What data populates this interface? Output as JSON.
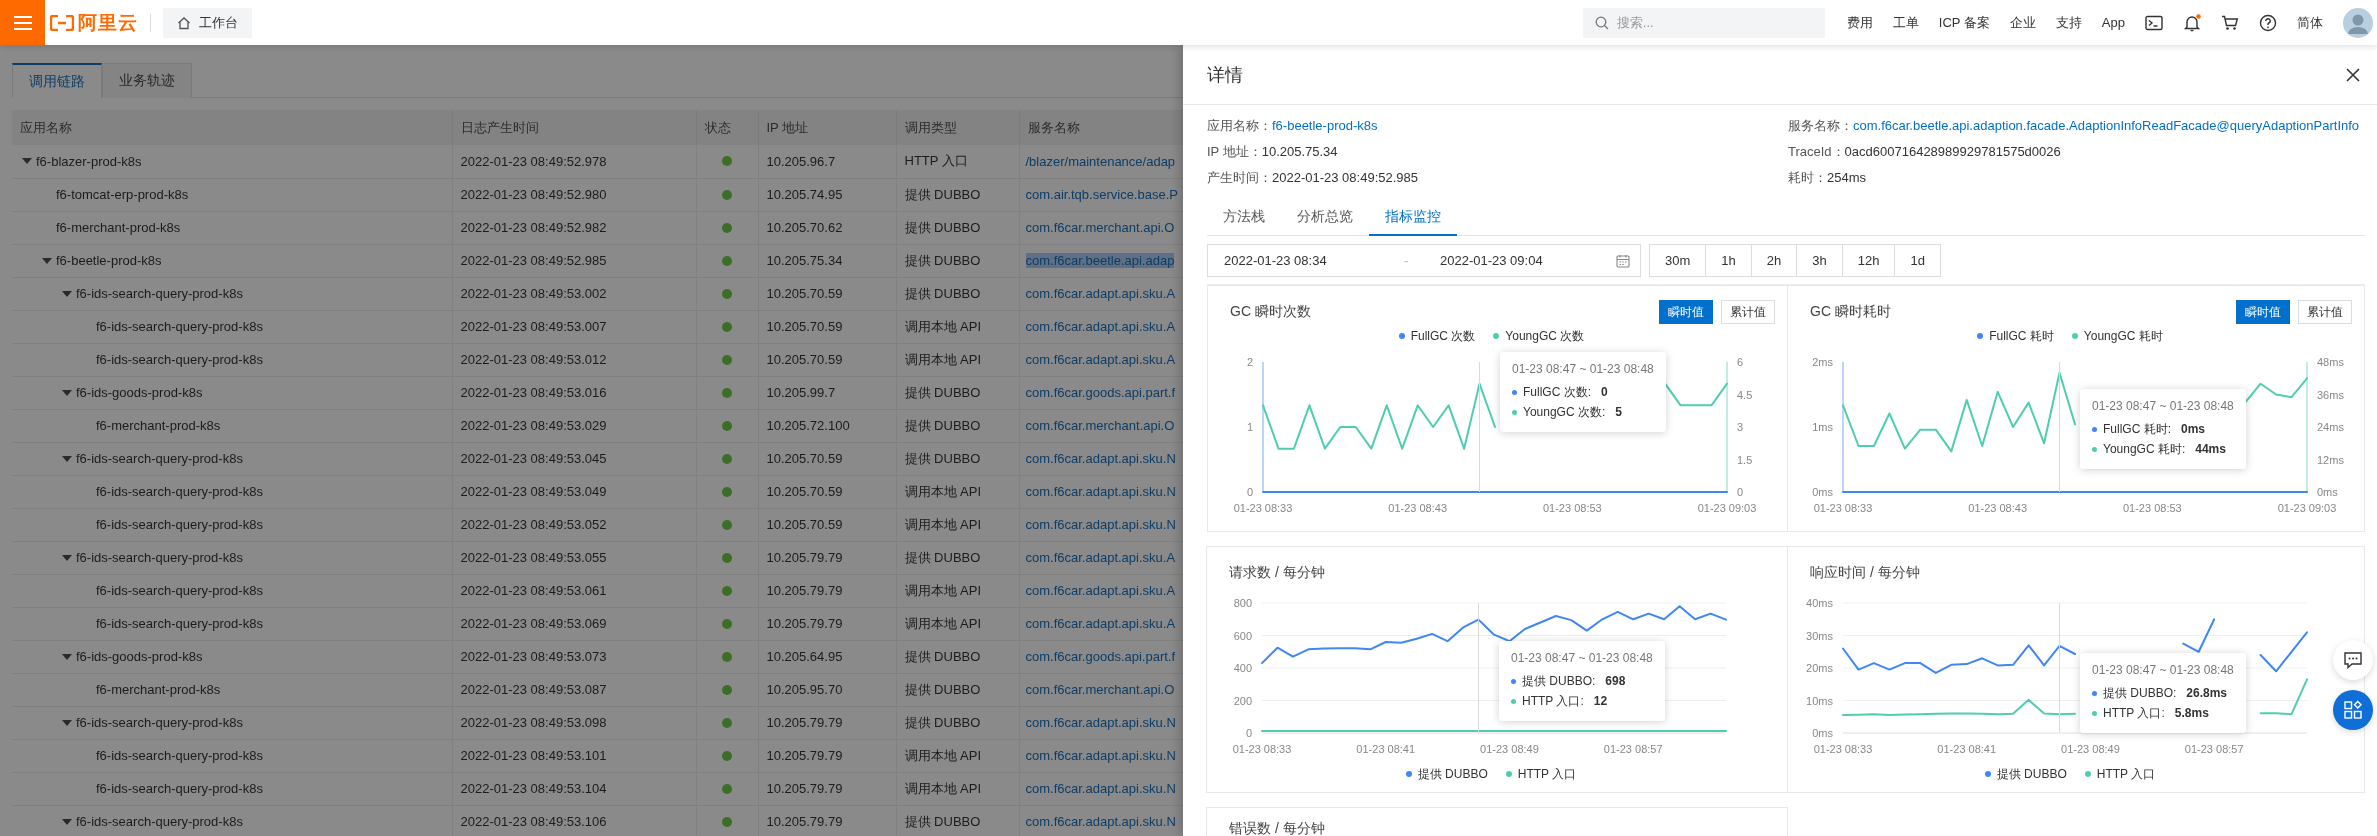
{
  "topbar": {
    "logo": "阿里云",
    "workbench": "工作台",
    "search": {
      "placeholder": "搜索..."
    },
    "links": [
      "费用",
      "工单",
      "ICP 备案",
      "企业",
      "支持",
      "App"
    ],
    "language": "简体"
  },
  "main": {
    "tabs": [
      {
        "label": "调用链路",
        "selected": true
      },
      {
        "label": "业务轨迹",
        "selected": false
      }
    ],
    "table": {
      "columns": [
        "应用名称",
        "日志产生时间",
        "状态",
        "IP 地址",
        "调用类型",
        "服务名称"
      ],
      "rows": [
        {
          "app": "f6-blazer-prod-k8s",
          "time": "2022-01-23 08:49:52.978",
          "ip": "10.205.96.7",
          "call_type": "HTTP 入口",
          "service": "/blazer/maintenance/adap",
          "selected": false,
          "expanded": true,
          "children": [
            {
              "app": "f6-tomcat-erp-prod-k8s",
              "time": "2022-01-23 08:49:52.980",
              "ip": "10.205.74.95",
              "call_type": "提供 DUBBO",
              "service": "com.air.tqb.service.base.P",
              "selected": false
            },
            {
              "app": "f6-merchant-prod-k8s",
              "time": "2022-01-23 08:49:52.982",
              "ip": "10.205.70.62",
              "call_type": "提供 DUBBO",
              "service": "com.f6car.merchant.api.O",
              "selected": false
            },
            {
              "app": "f6-beetle-prod-k8s",
              "time": "2022-01-23 08:49:52.985",
              "ip": "10.205.75.34",
              "call_type": "提供 DUBBO",
              "service": "com.f6car.beetle.api.adap",
              "selected": true,
              "expanded": true,
              "children": [
                {
                  "app": "f6-ids-search-query-prod-k8s",
                  "time": "2022-01-23 08:49:53.002",
                  "ip": "10.205.70.59",
                  "call_type": "提供 DUBBO",
                  "service": "com.f6car.adapt.api.sku.A",
                  "selected": false,
                  "expanded": true,
                  "children": [
                    {
                      "app": "f6-ids-search-query-prod-k8s",
                      "time": "2022-01-23 08:49:53.007",
                      "ip": "10.205.70.59",
                      "call_type": "调用本地 API",
                      "service": "com.f6car.adapt.api.sku.A",
                      "selected": false
                    },
                    {
                      "app": "f6-ids-search-query-prod-k8s",
                      "time": "2022-01-23 08:49:53.012",
                      "ip": "10.205.70.59",
                      "call_type": "调用本地 API",
                      "service": "com.f6car.adapt.api.sku.A",
                      "selected": false
                    }
                  ]
                },
                {
                  "app": "f6-ids-goods-prod-k8s",
                  "time": "2022-01-23 08:49:53.016",
                  "ip": "10.205.99.7",
                  "call_type": "提供 DUBBO",
                  "service": "com.f6car.goods.api.part.f",
                  "selected": false,
                  "expanded": true,
                  "children": [
                    {
                      "app": "f6-merchant-prod-k8s",
                      "time": "2022-01-23 08:49:53.029",
                      "ip": "10.205.72.100",
                      "call_type": "提供 DUBBO",
                      "service": "com.f6car.merchant.api.O",
                      "selected": false
                    }
                  ]
                },
                {
                  "app": "f6-ids-search-query-prod-k8s",
                  "time": "2022-01-23 08:49:53.045",
                  "ip": "10.205.70.59",
                  "call_type": "提供 DUBBO",
                  "service": "com.f6car.adapt.api.sku.N",
                  "selected": false,
                  "expanded": true,
                  "children": [
                    {
                      "app": "f6-ids-search-query-prod-k8s",
                      "time": "2022-01-23 08:49:53.049",
                      "ip": "10.205.70.59",
                      "call_type": "调用本地 API",
                      "service": "com.f6car.adapt.api.sku.N",
                      "selected": false
                    },
                    {
                      "app": "f6-ids-search-query-prod-k8s",
                      "time": "2022-01-23 08:49:53.052",
                      "ip": "10.205.70.59",
                      "call_type": "调用本地 API",
                      "service": "com.f6car.adapt.api.sku.N",
                      "selected": false
                    }
                  ]
                },
                {
                  "app": "f6-ids-search-query-prod-k8s",
                  "time": "2022-01-23 08:49:53.055",
                  "ip": "10.205.79.79",
                  "call_type": "提供 DUBBO",
                  "service": "com.f6car.adapt.api.sku.A",
                  "selected": false,
                  "expanded": true,
                  "children": [
                    {
                      "app": "f6-ids-search-query-prod-k8s",
                      "time": "2022-01-23 08:49:53.061",
                      "ip": "10.205.79.79",
                      "call_type": "调用本地 API",
                      "service": "com.f6car.adapt.api.sku.A",
                      "selected": false
                    },
                    {
                      "app": "f6-ids-search-query-prod-k8s",
                      "time": "2022-01-23 08:49:53.069",
                      "ip": "10.205.79.79",
                      "call_type": "调用本地 API",
                      "service": "com.f6car.adapt.api.sku.A",
                      "selected": false
                    }
                  ]
                },
                {
                  "app": "f6-ids-goods-prod-k8s",
                  "time": "2022-01-23 08:49:53.073",
                  "ip": "10.205.64.95",
                  "call_type": "提供 DUBBO",
                  "service": "com.f6car.goods.api.part.f",
                  "selected": false,
                  "expanded": true,
                  "children": [
                    {
                      "app": "f6-merchant-prod-k8s",
                      "time": "2022-01-23 08:49:53.087",
                      "ip": "10.205.95.70",
                      "call_type": "提供 DUBBO",
                      "service": "com.f6car.merchant.api.O",
                      "selected": false
                    }
                  ]
                },
                {
                  "app": "f6-ids-search-query-prod-k8s",
                  "time": "2022-01-23 08:49:53.098",
                  "ip": "10.205.79.79",
                  "call_type": "提供 DUBBO",
                  "service": "com.f6car.adapt.api.sku.N",
                  "selected": false,
                  "expanded": true,
                  "children": [
                    {
                      "app": "f6-ids-search-query-prod-k8s",
                      "time": "2022-01-23 08:49:53.101",
                      "ip": "10.205.79.79",
                      "call_type": "调用本地 API",
                      "service": "com.f6car.adapt.api.sku.N",
                      "selected": false
                    },
                    {
                      "app": "f6-ids-search-query-prod-k8s",
                      "time": "2022-01-23 08:49:53.104",
                      "ip": "10.205.79.79",
                      "call_type": "调用本地 API",
                      "service": "com.f6car.adapt.api.sku.N",
                      "selected": false
                    }
                  ]
                },
                {
                  "app": "f6-ids-search-query-prod-k8s",
                  "time": "2022-01-23 08:49:53.106",
                  "ip": "10.205.79.79",
                  "call_type": "提供 DUBBO",
                  "service": "com.f6car.adapt.api.sku.N",
                  "selected": false,
                  "expanded": true
                }
              ]
            }
          ]
        }
      ]
    }
  },
  "drawer": {
    "title": "详情",
    "info": [
      {
        "label": "应用名称：",
        "value": "f6-beetle-prod-k8s",
        "kind": "link"
      },
      {
        "label": "服务名称：",
        "value": "com.f6car.beetle.api.adaption.facade.AdaptionInfoReadFacade@queryAdaptionPartInfo",
        "kind": "link"
      },
      {
        "label": "IP 地址：",
        "value": "10.205.75.34",
        "kind": "text"
      },
      {
        "label": "TraceId：",
        "value": "0acd600716428989929781575d0026",
        "kind": "text"
      },
      {
        "label": "产生时间：",
        "value": "2022-01-23 08:49:52.985",
        "kind": "text"
      },
      {
        "label": "耗时：",
        "value": "254ms",
        "kind": "text"
      }
    ],
    "tabs": [
      {
        "label": "方法栈",
        "selected": false
      },
      {
        "label": "分析总览",
        "selected": false
      },
      {
        "label": "指标监控",
        "selected": true
      }
    ],
    "date_range": {
      "start": "2022-01-23 08:34",
      "separator": "-",
      "end": "2022-01-23 09:04"
    },
    "ranges": [
      {
        "label": "30m",
        "selected": false
      },
      {
        "label": "1h",
        "selected": false
      },
      {
        "label": "2h",
        "selected": false
      },
      {
        "label": "3h",
        "selected": false
      },
      {
        "label": "12h",
        "selected": false
      },
      {
        "label": "1d",
        "selected": false
      }
    ],
    "charts": [
      {
        "title": "GC 瞬时次数",
        "modes": [
          {
            "label": "瞬时值",
            "selected": true
          },
          {
            "label": "累计值",
            "selected": false
          }
        ],
        "tooltip": {
          "title": "01-23 08:47 ~ 01-23 08:48",
          "items": [
            {
              "label": "FullGC 次数:",
              "value": "0"
            },
            {
              "label": "YoungGC 次数:",
              "value": "5"
            }
          ]
        },
        "chart_data": {
          "type": "line",
          "categories": [
            "01-23 08:33",
            null,
            null,
            null,
            null,
            null,
            null,
            null,
            null,
            null,
            "01-23 08:43",
            null,
            null,
            null,
            null,
            null,
            null,
            null,
            null,
            null,
            "01-23 08:53",
            null,
            null,
            null,
            null,
            null,
            null,
            null,
            null,
            null,
            "01-23 09:03"
          ],
          "series": [
            {
              "name": "FullGC 次数",
              "color": "#3f87f5",
              "values": [
                0,
                0,
                0,
                0,
                0,
                0,
                0,
                0,
                0,
                0,
                0,
                0,
                0,
                0,
                0,
                0,
                0,
                0,
                0,
                0,
                0,
                0,
                0,
                0,
                0,
                0,
                0,
                0,
                0,
                0,
                0
              ]
            },
            {
              "name": "YoungGC 次数",
              "color": "#4fcdb0",
              "axis": "y2",
              "values": [
                4,
                2,
                2,
                4,
                2,
                3,
                3,
                2,
                4,
                2,
                4,
                3,
                4,
                2,
                5,
                3,
                null,
                null,
                null,
                null,
                null,
                null,
                null,
                null,
                null,
                null,
                5,
                4,
                4,
                4,
                5
              ]
            }
          ],
          "ylim": [
            0,
            2
          ],
          "yticks": [
            0,
            1,
            2
          ],
          "y2lim": [
            0,
            6
          ],
          "y2ticks": [
            0,
            1.5,
            3,
            4.5,
            6
          ]
        }
      },
      {
        "title": "GC 瞬时耗时",
        "modes": [
          {
            "label": "瞬时值",
            "selected": true
          },
          {
            "label": "累计值",
            "selected": false
          }
        ],
        "tooltip": {
          "title": "01-23 08:47 ~ 01-23 08:48",
          "items": [
            {
              "label": "FullGC 耗时:",
              "value": "0ms"
            },
            {
              "label": "YoungGC 耗时:",
              "value": "44ms"
            }
          ]
        },
        "chart_data": {
          "type": "line",
          "categories": [
            "01-23 08:33",
            null,
            null,
            null,
            null,
            null,
            null,
            null,
            null,
            null,
            "01-23 08:43",
            null,
            null,
            null,
            null,
            null,
            null,
            null,
            null,
            null,
            "01-23 08:53",
            null,
            null,
            null,
            null,
            null,
            null,
            null,
            null,
            null,
            "01-23 09:03"
          ],
          "series": [
            {
              "name": "FullGC 耗时",
              "color": "#3f87f5",
              "values": [
                0,
                0,
                0,
                0,
                0,
                0,
                0,
                0,
                0,
                0,
                0,
                0,
                0,
                0,
                0,
                0,
                0,
                0,
                0,
                0,
                0,
                0,
                0,
                0,
                0,
                0,
                0,
                0,
                0,
                0,
                0
              ]
            },
            {
              "name": "YoungGC 耗时",
              "color": "#4fcdb0",
              "axis": "y2",
              "values": [
                32,
                17,
                17,
                29,
                16,
                23,
                23,
                15,
                34,
                17,
                37,
                24,
                33,
                18,
                44,
                25,
                null,
                null,
                null,
                null,
                null,
                null,
                null,
                null,
                null,
                null,
                33,
                40,
                36,
                35,
                42
              ]
            }
          ],
          "ylim": [
            0,
            2
          ],
          "yticks": [
            {
              "value": 0,
              "label": "0ms"
            },
            {
              "value": 1,
              "label": "1ms"
            },
            {
              "value": 2,
              "label": "2ms"
            }
          ],
          "y2lim": [
            0,
            48
          ],
          "y2ticks": [
            {
              "value": 0,
              "label": "0ms"
            },
            {
              "value": 12,
              "label": "12ms"
            },
            {
              "value": 24,
              "label": "24ms"
            },
            {
              "value": 36,
              "label": "36ms"
            },
            {
              "value": 48,
              "label": "48ms"
            }
          ]
        }
      },
      {
        "title": "请求数 / 每分钟",
        "tooltip": {
          "title": "01-23 08:47 ~ 01-23 08:48",
          "items": [
            {
              "label": "提供 DUBBO:",
              "value": "698"
            },
            {
              "label": "HTTP 入口:",
              "value": "12"
            }
          ]
        },
        "chart_data": {
          "type": "line",
          "categories": [
            "01-23 08:33",
            null,
            null,
            null,
            null,
            null,
            null,
            null,
            "01-23 08:41",
            null,
            null,
            null,
            null,
            null,
            null,
            null,
            "01-23 08:49",
            null,
            null,
            null,
            null,
            null,
            null,
            null,
            "01-23 08:57",
            null,
            null,
            null,
            null,
            null,
            null
          ],
          "series": [
            {
              "name": "提供 DUBBO",
              "color": "#3f87f5",
              "values": [
                430,
                525,
                470,
                515,
                520,
                522,
                522,
                515,
                560,
                555,
                580,
                610,
                565,
                650,
                698,
                605,
                565,
                640,
                680,
                720,
                695,
                630,
                700,
                745,
                700,
                735,
                700,
                780,
                700,
                735,
                698
              ]
            },
            {
              "name": "HTTP 入口",
              "color": "#4fcdb0",
              "values": [
                12,
                12,
                12,
                12,
                12,
                12,
                12,
                12,
                12,
                12,
                12,
                12,
                12,
                12,
                12,
                12,
                12,
                12,
                12,
                12,
                12,
                12,
                12,
                12,
                12,
                12,
                12,
                12,
                12,
                12,
                12
              ]
            }
          ],
          "ylim": [
            0,
            800
          ],
          "yticks": [
            0,
            200,
            400,
            600,
            800
          ],
          "grid": true
        }
      },
      {
        "title": "响应时间 / 每分钟",
        "tooltip": {
          "title": "01-23 08:47 ~ 01-23 08:48",
          "items": [
            {
              "label": "提供 DUBBO:",
              "value": "26.8ms"
            },
            {
              "label": "HTTP 入口:",
              "value": "5.8ms"
            }
          ]
        },
        "chart_data": {
          "type": "line",
          "categories": [
            "01-23 08:33",
            null,
            null,
            null,
            null,
            null,
            null,
            null,
            "01-23 08:41",
            null,
            null,
            null,
            null,
            null,
            null,
            null,
            "01-23 08:49",
            null,
            null,
            null,
            null,
            null,
            null,
            null,
            "01-23 08:57",
            null,
            null,
            null,
            null,
            null,
            null
          ],
          "series": [
            {
              "name": "提供 DUBBO",
              "color": "#3f87f5",
              "values": [
                26,
                19.5,
                21.5,
                19.5,
                21.5,
                21.5,
                18.5,
                21,
                21.2,
                23,
                20.8,
                21,
                27,
                20.8,
                26.8,
                24.3,
                null,
                null,
                null,
                null,
                null,
                null,
                27.5,
                25,
                35,
                null,
                null,
                24,
                19,
                25,
                31
              ]
            },
            {
              "name": "HTTP 入口",
              "color": "#4fcdb0",
              "values": [
                5.5,
                5.6,
                5.8,
                5.5,
                5.7,
                5.8,
                5.9,
                6,
                6,
                5.9,
                5.8,
                5.9,
                10.2,
                6,
                5.8,
                5.9,
                null,
                null,
                null,
                null,
                null,
                null,
                null,
                null,
                null,
                null,
                null,
                6.1,
                6.1,
                5.8,
                16.5
              ]
            }
          ],
          "ylim": [
            0,
            40
          ],
          "yticks": [
            {
              "value": 0,
              "label": "0ms"
            },
            {
              "value": 10,
              "label": "10ms"
            },
            {
              "value": 20,
              "label": "20ms"
            },
            {
              "value": 30,
              "label": "30ms"
            },
            {
              "value": 40,
              "label": "40ms"
            }
          ],
          "grid": true
        }
      }
    ],
    "next_section": {
      "title": "错误数 / 每分钟"
    }
  }
}
